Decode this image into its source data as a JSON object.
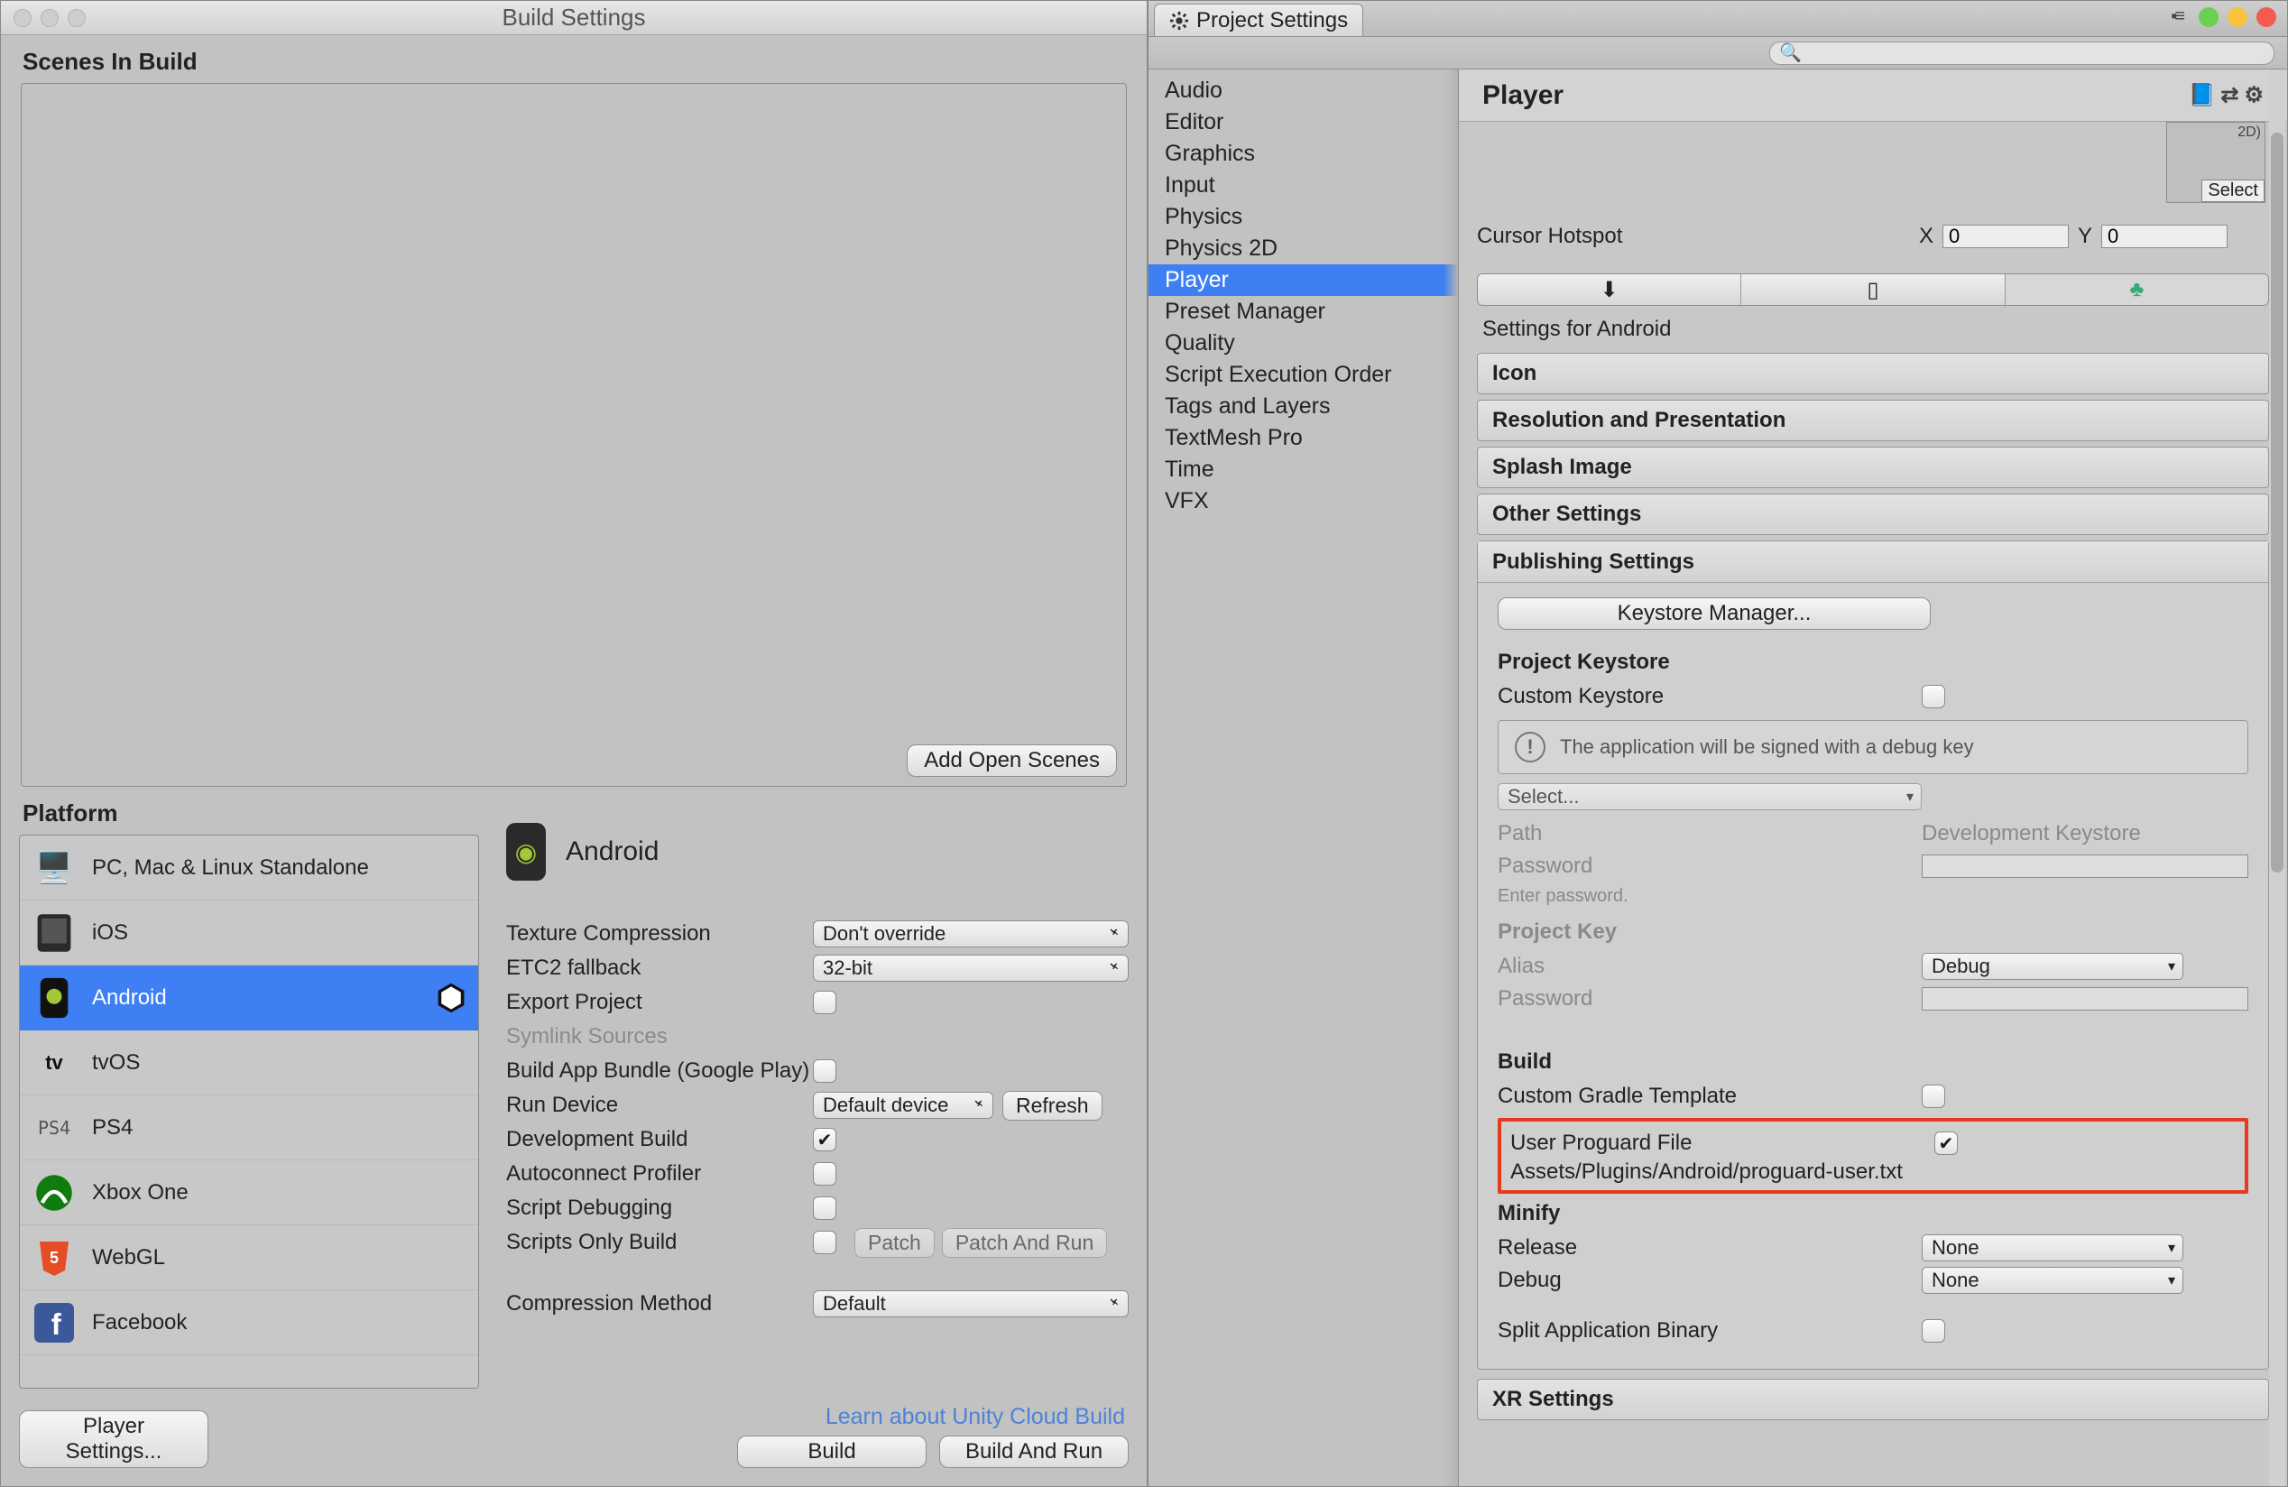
{
  "build": {
    "window_title": "Build Settings",
    "scenes_label": "Scenes In Build",
    "add_open_scenes": "Add Open Scenes",
    "platform_label": "Platform",
    "platforms": [
      {
        "label": "PC, Mac & Linux Standalone"
      },
      {
        "label": "iOS"
      },
      {
        "label": "Android",
        "selected": true
      },
      {
        "label": "tvOS"
      },
      {
        "label": "PS4"
      },
      {
        "label": "Xbox One"
      },
      {
        "label": "WebGL"
      },
      {
        "label": "Facebook"
      }
    ],
    "player_settings_btn": "Player Settings...",
    "details_title": "Android",
    "fields": {
      "texture_compression": {
        "label": "Texture Compression",
        "value": "Don't override"
      },
      "etc2": {
        "label": "ETC2 fallback",
        "value": "32-bit"
      },
      "export_project": {
        "label": "Export Project",
        "checked": false
      },
      "symlink": {
        "label": "Symlink Sources",
        "disabled": true
      },
      "aab": {
        "label": "Build App Bundle (Google Play)",
        "checked": false
      },
      "run_device": {
        "label": "Run Device",
        "value": "Default device",
        "refresh": "Refresh"
      },
      "dev_build": {
        "label": "Development Build",
        "checked": true
      },
      "autoconnect": {
        "label": "Autoconnect Profiler",
        "checked": false
      },
      "script_debug": {
        "label": "Script Debugging",
        "checked": false
      },
      "scripts_only": {
        "label": "Scripts Only Build",
        "checked": false,
        "patch": "Patch",
        "patch_run": "Patch And Run"
      },
      "compression": {
        "label": "Compression Method",
        "value": "Default"
      }
    },
    "cloud_link": "Learn about Unity Cloud Build",
    "build_btn": "Build",
    "build_run_btn": "Build And Run"
  },
  "proj": {
    "tab_title": "Project Settings",
    "search_placeholder": "",
    "categories": [
      "Audio",
      "Editor",
      "Graphics",
      "Input",
      "Physics",
      "Physics 2D",
      "Player",
      "Preset Manager",
      "Quality",
      "Script Execution Order",
      "Tags and Layers",
      "TextMesh Pro",
      "Time",
      "VFX"
    ],
    "selected_category": "Player",
    "inspector_title": "Player",
    "thumb_label": "2D)",
    "thumb_select": "Select",
    "cursor": {
      "label": "Cursor Hotspot",
      "x_label": "X",
      "x": "0",
      "y_label": "Y",
      "y": "0"
    },
    "settings_for": "Settings for Android",
    "folds": [
      "Icon",
      "Resolution and Presentation",
      "Splash Image",
      "Other Settings"
    ],
    "publishing": {
      "title": "Publishing Settings",
      "keystore_manager": "Keystore Manager...",
      "project_keystore": "Project Keystore",
      "custom_keystore": {
        "label": "Custom Keystore",
        "checked": false
      },
      "debug_note": "The application will be signed with a debug key",
      "select": "Select...",
      "path": {
        "label": "Path",
        "value": "Development Keystore"
      },
      "password": {
        "label": "Password",
        "hint": "Enter password."
      },
      "project_key": "Project Key",
      "alias": {
        "label": "Alias",
        "value": "Debug"
      },
      "password2": {
        "label": "Password"
      },
      "build_h": "Build",
      "gradle": {
        "label": "Custom Gradle Template",
        "checked": false
      },
      "proguard": {
        "label": "User Proguard File",
        "checked": true,
        "path": "Assets/Plugins/Android/proguard-user.txt"
      },
      "minify_h": "Minify",
      "release": {
        "label": "Release",
        "value": "None"
      },
      "debug": {
        "label": "Debug",
        "value": "None"
      },
      "sab": {
        "label": "Split Application Binary",
        "checked": false
      }
    },
    "xr_fold": "XR Settings"
  }
}
